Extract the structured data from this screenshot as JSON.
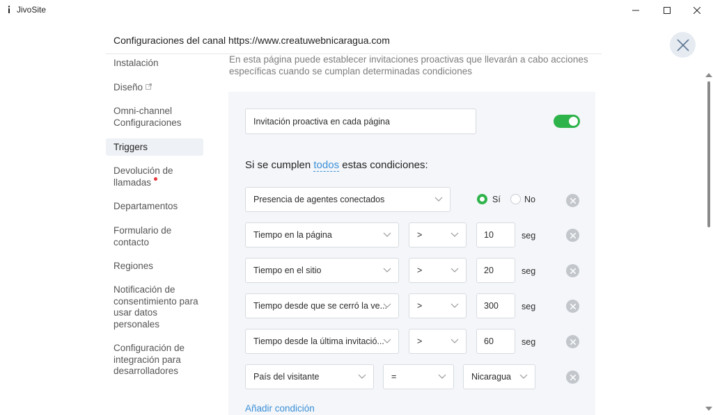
{
  "window": {
    "title": "JivoSite"
  },
  "header": {
    "title": "Configuraciones del canal https://www.creatuwebnicaragua.com"
  },
  "sidebar": {
    "items": [
      {
        "label": "Instalación"
      },
      {
        "label": "Diseño"
      },
      {
        "label": "Omni-channel Configuraciones"
      },
      {
        "label": "Triggers",
        "active": true
      },
      {
        "label": "Devolución de llamadas"
      },
      {
        "label": "Departamentos"
      },
      {
        "label": "Formulario de contacto"
      },
      {
        "label": "Regiones"
      },
      {
        "label": "Notificación de consentimiento para usar datos personales"
      },
      {
        "label": "Configuración de integración para desarrolladores"
      }
    ]
  },
  "main": {
    "description": "En esta página puede establecer invitaciones proactivas que llevarán a cabo acciones específicas cuando se cumplan determinadas condiciones",
    "trigger_name": "Invitación proactiva en cada página",
    "trigger_enabled": true,
    "conditions_prefix": "Si se cumplen",
    "conditions_link": "todos",
    "conditions_suffix": "estas condiciones:",
    "conditions": [
      {
        "field": "Presencia de agentes conectados",
        "options": [
          "Sí",
          "No"
        ],
        "selected": "Sí"
      },
      {
        "field": "Tiempo en la página",
        "operator": ">",
        "value": "10",
        "unit": "seg"
      },
      {
        "field": "Tiempo en el sitio",
        "operator": ">",
        "value": "20",
        "unit": "seg"
      },
      {
        "field": "Tiempo desde que se cerró la ve...",
        "operator": ">",
        "value": "300",
        "unit": "seg"
      },
      {
        "field": "Tiempo desde la última invitació...",
        "operator": ">",
        "value": "60",
        "unit": "seg"
      },
      {
        "field": "País del visitante",
        "operator": "=",
        "value": "Nicaragua"
      }
    ],
    "add_condition": "Añadir condición"
  },
  "colors": {
    "accent_green": "#2db34a",
    "link_blue": "#3a8fd8",
    "notification_red": "#e8363b"
  }
}
